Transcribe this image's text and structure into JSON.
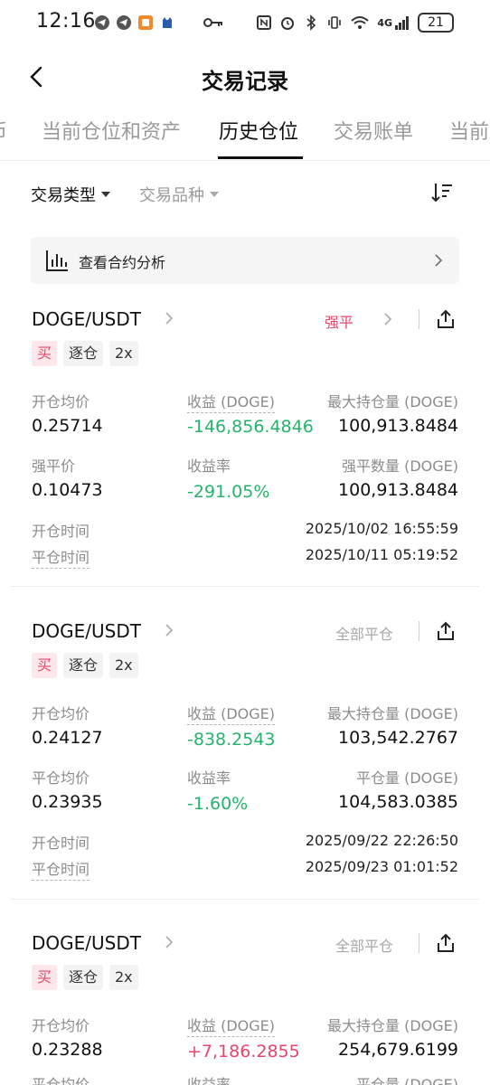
{
  "status_bar": {
    "time": "12:16",
    "network": "4G",
    "battery": "21"
  },
  "header": {
    "title": "交易记录"
  },
  "tabs": [
    {
      "label": "币"
    },
    {
      "label": "当前仓位和资产"
    },
    {
      "label": "历史仓位",
      "active": true
    },
    {
      "label": "交易账单"
    },
    {
      "label": "当前"
    }
  ],
  "filters": {
    "trade_type": "交易类型",
    "instrument": "交易品种"
  },
  "analysis": {
    "label": "查看合约分析"
  },
  "cards": [
    {
      "symbol": "DOGE/USDT",
      "status": "强平",
      "tags": [
        "买",
        "逐仓",
        "2x"
      ],
      "row1": {
        "l_label": "开仓均价",
        "l_value": "0.25714",
        "m_label": "收益 (DOGE)",
        "m_value": "-146,856.4846",
        "r_label": "最大持仓量 (DOGE)",
        "r_value": "100,913.8484"
      },
      "row2": {
        "l_label": "强平价",
        "l_value": "0.10473",
        "m_label": "收益率",
        "m_value": "-291.05%",
        "r_label": "强平数量 (DOGE)",
        "r_value": "100,913.8484"
      },
      "open_label": "开仓时间",
      "open_time": "2025/10/02 16:55:59",
      "close_label": "平仓时间",
      "close_time": "2025/10/11 05:19:52"
    },
    {
      "symbol": "DOGE/USDT",
      "status": "全部平仓",
      "tags": [
        "买",
        "逐仓",
        "2x"
      ],
      "row1": {
        "l_label": "开仓均价",
        "l_value": "0.24127",
        "m_label": "收益 (DOGE)",
        "m_value": "-838.2543",
        "r_label": "最大持仓量 (DOGE)",
        "r_value": "103,542.2767"
      },
      "row2": {
        "l_label": "平仓均价",
        "l_value": "0.23935",
        "m_label": "收益率",
        "m_value": "-1.60%",
        "r_label": "平仓量 (DOGE)",
        "r_value": "104,583.0385"
      },
      "open_label": "开仓时间",
      "open_time": "2025/09/22 22:26:50",
      "close_label": "平仓时间",
      "close_time": "2025/09/23 01:01:52"
    },
    {
      "symbol": "DOGE/USDT",
      "status": "全部平仓",
      "tags": [
        "买",
        "逐仓",
        "2x"
      ],
      "row1": {
        "l_label": "开仓均价",
        "l_value": "0.23288",
        "m_label": "收益 (DOGE)",
        "m_value": "+7,186.2855",
        "r_label": "最大持仓量 (DOGE)",
        "r_value": "254,679.6199"
      },
      "row2": {
        "l_label": "平仓均价",
        "m_label": "收益率",
        "r_label": "平仓量 (DOGE)"
      }
    }
  ],
  "colors": {
    "loss": "#26b36b",
    "gain": "#e8466b",
    "liquidation": "#e8466b",
    "closed": "#a8a8a8"
  }
}
